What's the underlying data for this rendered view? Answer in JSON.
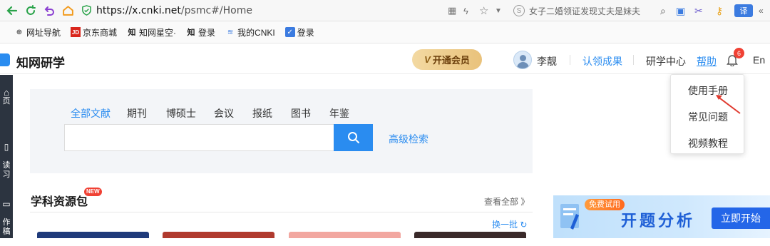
{
  "browser": {
    "url_domain": "https://x.cnki.net",
    "url_path": "/psmc#/Home",
    "search_text": "女子二婚领证发现丈夫是妹夫",
    "bookmarks": [
      "网址导航",
      "京东商城",
      "知网星空·",
      "登录",
      "我的CNKI",
      "登录"
    ]
  },
  "header": {
    "logo": "知网研学",
    "vip": "开通会员",
    "user": "李靓",
    "claim": "认领成果",
    "center": "研学中心",
    "help": "帮助",
    "badge": "6",
    "lang": "En"
  },
  "sidebar": {
    "items": [
      "页",
      "读\n习",
      "作\n稿"
    ]
  },
  "search": {
    "tabs": [
      "全部文献",
      "期刊",
      "博硕士",
      "会议",
      "报纸",
      "图书",
      "年鉴"
    ],
    "active_tab": "全部文献",
    "placeholder": "",
    "advanced": "高级检索"
  },
  "resources": {
    "title": "学科资源包",
    "badge": "NEW",
    "view_all": "查看全部 》",
    "refresh": "换一批"
  },
  "help_menu": {
    "items": [
      "使用手册",
      "常见问题",
      "视频教程"
    ]
  },
  "banner": {
    "tag": "免费试用",
    "title": "开题分析",
    "button": "立即开始"
  },
  "colors": {
    "accent": "#2a8cf0",
    "badge_red": "#f04134",
    "vip_gold": "#e9c27b"
  }
}
